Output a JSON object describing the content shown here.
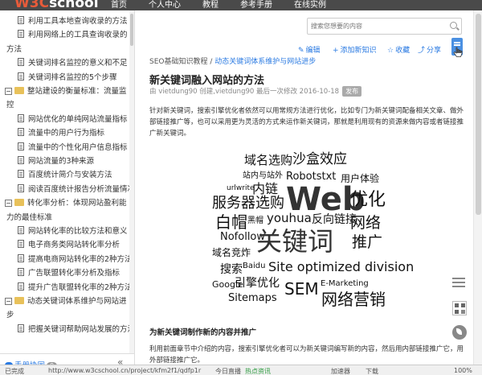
{
  "header": {
    "logo_w3c": "W3C",
    "logo_school": "school",
    "nav": [
      "首页",
      "个人中心",
      "教程",
      "参考手册",
      "在线实例"
    ]
  },
  "sidebar": {
    "items": [
      {
        "type": "doc",
        "label": "利用工具本地查询收录的方法"
      },
      {
        "type": "doc",
        "label": "利用网络上的工具查询收录的"
      },
      {
        "type": "wrap",
        "label": "方法"
      },
      {
        "type": "doc",
        "label": "关键词排名监控的意义和不足"
      },
      {
        "type": "doc",
        "label": "关键词排名监控的5个步骤"
      },
      {
        "type": "folder",
        "label": "整站建设的衡量标准：流量监"
      },
      {
        "type": "wrap",
        "label": "控"
      },
      {
        "type": "doc",
        "label": "网站优化的单纯网站流量指标"
      },
      {
        "type": "doc",
        "label": "流量中的用户行为指标"
      },
      {
        "type": "doc",
        "label": "流量中的个性化用户信息指标"
      },
      {
        "type": "doc",
        "label": "网站流量的3种来源"
      },
      {
        "type": "doc",
        "label": "百度统计简介与安装方法"
      },
      {
        "type": "doc",
        "label": "阅读百度统计报告分析流量情况"
      },
      {
        "type": "folder",
        "label": "转化率分析：体现网站盈利能"
      },
      {
        "type": "wrap",
        "label": "力的最佳标准"
      },
      {
        "type": "doc",
        "label": "网站转化率的比较方法和意义"
      },
      {
        "type": "doc",
        "label": "电子商务类网站转化率分析"
      },
      {
        "type": "doc",
        "label": "提高电商网站转化率的2种方法"
      },
      {
        "type": "doc",
        "label": "广告联盟转化率分析及指标"
      },
      {
        "type": "doc",
        "label": "提升广告联盟转化率的2种方法"
      },
      {
        "type": "folder",
        "label": "动态关键词体系维护与网站进"
      },
      {
        "type": "wrap",
        "label": "步"
      },
      {
        "type": "doc",
        "label": "把握关键词帮助网站发展的方法"
      }
    ],
    "help_label": "手册协同",
    "help_count": "0",
    "collapse_label": "«"
  },
  "search": {
    "placeholder": "搜索您想要的内容"
  },
  "toolbar": {
    "edit_label": "编辑",
    "add_label": "添加新知识",
    "collect_label": "收藏",
    "share_label": "分享"
  },
  "breadcrumb": {
    "root": "SEO基础知识教程",
    "sep": " / ",
    "current": "动态关键词体系维护与网站进步"
  },
  "article": {
    "title": "新关键词融入网站的方法",
    "meta": "由 vietdung90 创建,vietdung90 最后一次修改 2016-10-18",
    "publish_label": "发布",
    "intro": "针对新关键词，搜索引擎优化者依然可以用常规方法进行优化，比如专门为新关键词配备相关文章、做外部链接推广等，也可以采用更为灵活的方式来运作新关键词，那就是利用现有的资源来做内容或者链接推广新关键词。",
    "section_title": "为新关键词制作新的内容并推广",
    "section_text": "利用前面章节中介绍的内容，搜索引擎优化者可以为新关键词编写新的内容，然后用内部链接推广它，用外部链接推广它。"
  },
  "word_cloud": [
    {
      "text": "域名选购",
      "size": 15
    },
    {
      "text": "沙盒效应",
      "size": 17
    },
    {
      "text": "站内与站外",
      "size": 10
    },
    {
      "text": "Robotstxt",
      "size": 13
    },
    {
      "text": "用户体验",
      "size": 12
    },
    {
      "text": "urlwrite",
      "size": 9
    },
    {
      "text": "内链",
      "size": 16
    },
    {
      "text": "Web",
      "size": 40
    },
    {
      "text": "优化",
      "size": 22
    },
    {
      "text": "服务器选购",
      "size": 18
    },
    {
      "text": "白帽",
      "size": 20
    },
    {
      "text": "黑帽",
      "size": 10
    },
    {
      "text": "youhua",
      "size": 15
    },
    {
      "text": "反向链接",
      "size": 14
    },
    {
      "text": "网络",
      "size": 19
    },
    {
      "text": "Nofollow",
      "size": 13
    },
    {
      "text": "关键词",
      "size": 32
    },
    {
      "text": "推广",
      "size": 19
    },
    {
      "text": "域名竞炸",
      "size": 12
    },
    {
      "text": "搜索",
      "size": 14
    },
    {
      "text": "Baidu",
      "size": 10
    },
    {
      "text": "Site optimized division",
      "size": 16
    },
    {
      "text": "Google",
      "size": 11
    },
    {
      "text": "引擎优化",
      "size": 14
    },
    {
      "text": "SEM",
      "size": 20
    },
    {
      "text": "E-Marketing",
      "size": 10
    },
    {
      "text": "Sitemaps",
      "size": 13
    },
    {
      "text": "网络营销",
      "size": 20
    }
  ],
  "statusbar": {
    "left": "已完成",
    "url": "http://www.w3cschool.cn/project/kfm2f1/qdfp1r",
    "broadcast": "今日直播",
    "browser": "热点资讯",
    "speed": "加速器",
    "download": "下载",
    "zoom": "100%"
  },
  "colors": {
    "accent": "#2a7ae2",
    "logo": "#e85b3a",
    "topbar": "#4a4a4a",
    "folder": "#e8c15a"
  }
}
